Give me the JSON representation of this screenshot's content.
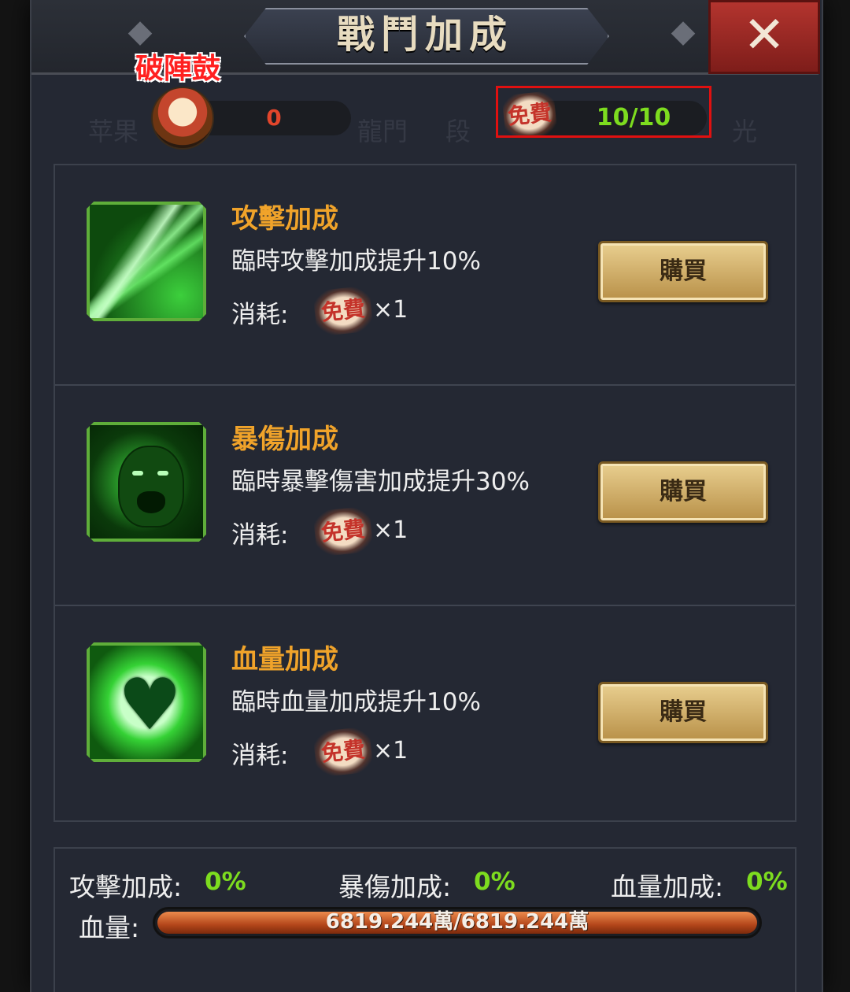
{
  "header": {
    "title": "戰鬥加成",
    "close_icon": "close-x-icon"
  },
  "currency": {
    "drum_label": "破陣鼓",
    "drum_icon": "war-drum-icon",
    "drum_count": "0",
    "free_stamp": "免費",
    "free_count": "10/10",
    "faded_background_text": [
      "苹果",
      "龍門",
      "段",
      "光"
    ]
  },
  "items": [
    {
      "title": "攻擊加成",
      "desc": "臨時攻擊加成提升10%",
      "cost_label": "消耗:",
      "cost_stamp": "免費",
      "cost_qty": "×1",
      "buy_label": "購買",
      "icon": "attack-slash-icon"
    },
    {
      "title": "暴傷加成",
      "desc": "臨時暴擊傷害加成提升30%",
      "cost_label": "消耗:",
      "cost_stamp": "免費",
      "cost_qty": "×1",
      "buy_label": "購買",
      "icon": "roaring-warrior-icon"
    },
    {
      "title": "血量加成",
      "desc": "臨時血量加成提升10%",
      "cost_label": "消耗:",
      "cost_stamp": "免費",
      "cost_qty": "×1",
      "buy_label": "購買",
      "icon": "heart-icon"
    }
  ],
  "stats": {
    "attack_label": "攻擊加成:",
    "attack_value": "0%",
    "crit_label": "暴傷加成:",
    "crit_value": "0%",
    "hp_bonus_label": "血量加成:",
    "hp_bonus_value": "0%",
    "hp_label": "血量:",
    "hp_text": "6819.244萬/6819.244萬",
    "hp_fraction": 1.0
  },
  "colors": {
    "title_orange": "#f0a32a",
    "value_green": "#7ddc1f",
    "drum_count_red": "#e2452b",
    "highlight_red": "#e01010"
  }
}
